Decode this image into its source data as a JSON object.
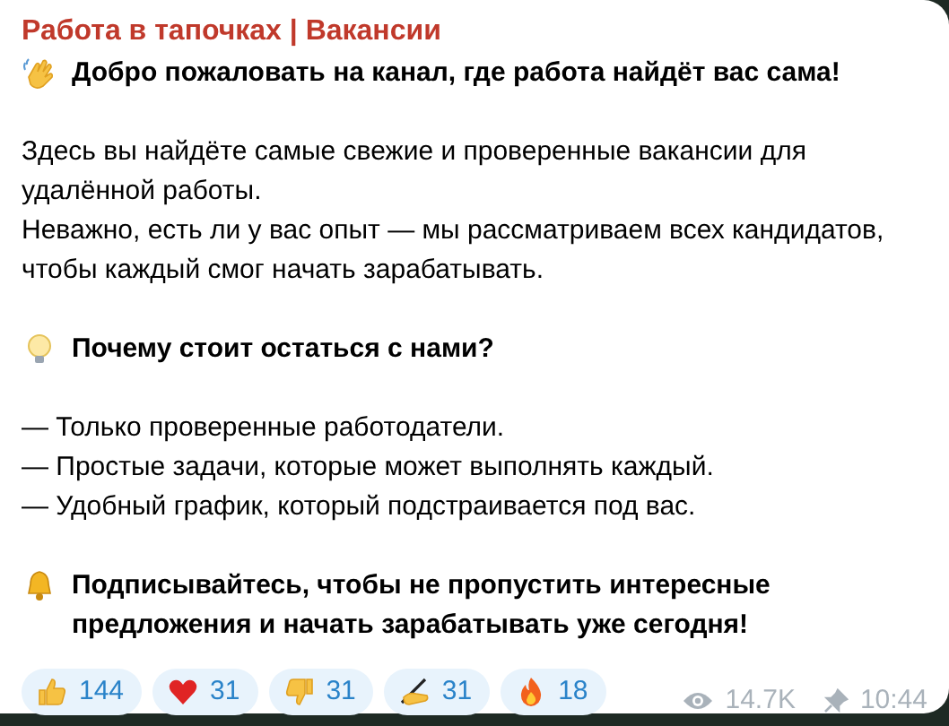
{
  "channel_name": "Работа в тапочках | Вакансии",
  "blocks": [
    {
      "kind": "heading",
      "text": "Добро пожаловать на канал, где работа найдёт вас сама!"
    },
    {
      "kind": "paragraph",
      "lines": [
        "Здесь вы найдёте самые свежие и проверенные вакансии для удалённой работы.",
        "Неважно, есть ли у вас опыт — мы рассматриваем всех кандидатов, чтобы каждый смог начать зарабатывать."
      ]
    },
    {
      "kind": "heading",
      "text": "Почему стоит остаться с нами?"
    },
    {
      "kind": "paragraph",
      "lines": [
        "— Только проверенные работодатели.",
        "— Простые задачи, которые может выполнять каждый.",
        "— Удобный график, который подстраивается под вас."
      ]
    },
    {
      "kind": "heading",
      "text": "Подписывайтесь, чтобы не пропустить интересные предложения и начать зарабатывать уже сегодня!"
    }
  ],
  "reactions": [
    {
      "count": "144"
    },
    {
      "count": "31"
    },
    {
      "count": "31"
    },
    {
      "count": "31"
    },
    {
      "count": "18"
    }
  ],
  "views": "14.7K",
  "time": "10:44"
}
